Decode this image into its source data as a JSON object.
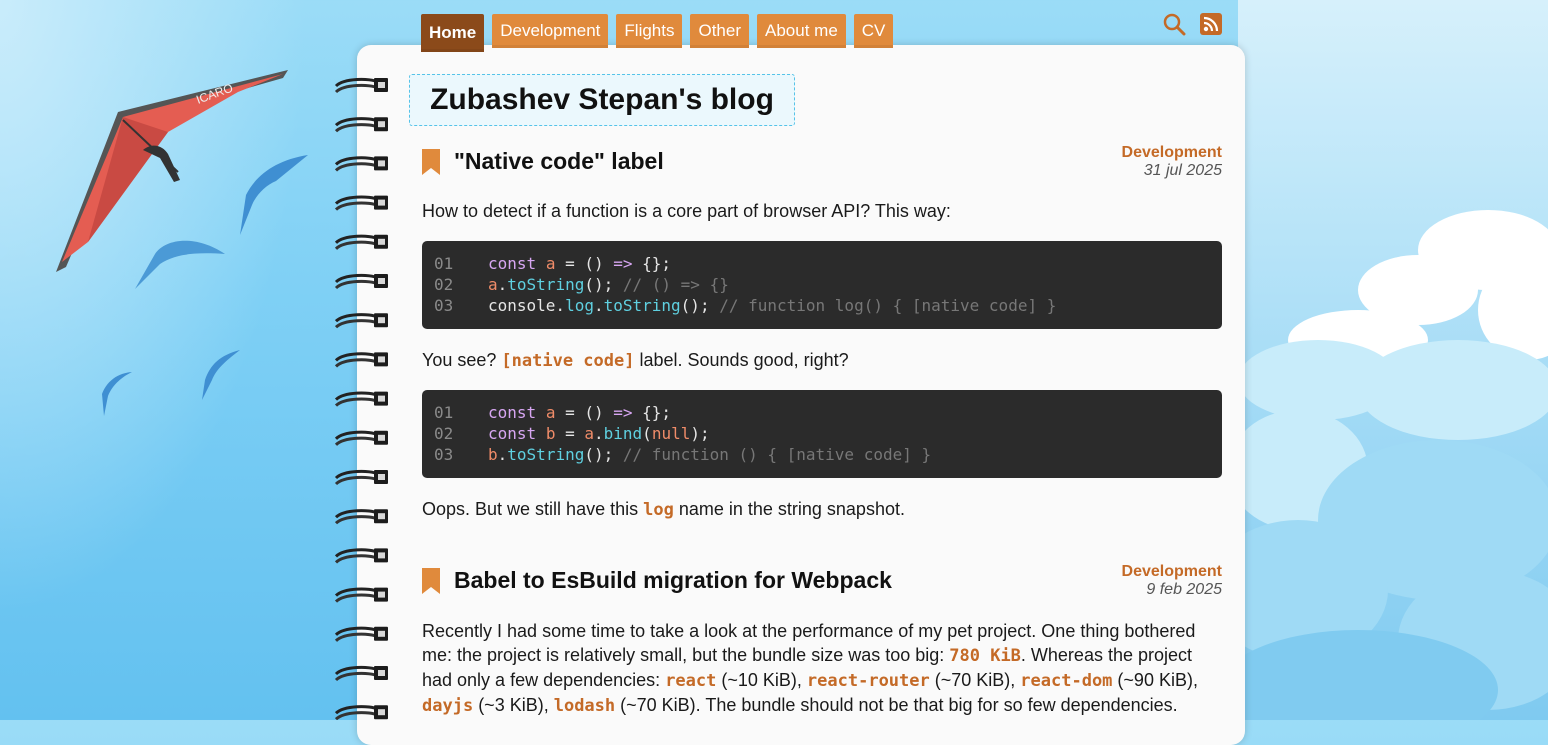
{
  "nav": {
    "tabs": [
      {
        "label": "Home",
        "active": true
      },
      {
        "label": "Development",
        "active": false
      },
      {
        "label": "Flights",
        "active": false
      },
      {
        "label": "Other",
        "active": false
      },
      {
        "label": "About me",
        "active": false
      },
      {
        "label": "CV",
        "active": false
      }
    ],
    "icons": [
      "search-icon",
      "rss-icon"
    ]
  },
  "blog_title": "Zubashev Stepan's blog",
  "posts": [
    {
      "title": "\"Native code\" label",
      "category": "Development",
      "date": "31 jul 2025",
      "intro": "How to detect if a function is a core part of browser API? This way:",
      "code1": [
        {
          "n": "01",
          "text": "const a = () => {};"
        },
        {
          "n": "02",
          "text": "a.toString(); // () => {}"
        },
        {
          "n": "03",
          "text": "console.log.toString(); // function log() { [native code] }"
        }
      ],
      "para2_before": "You see? ",
      "para2_code": "[native code]",
      "para2_after": " label. Sounds good, right?",
      "code2": [
        {
          "n": "01",
          "text": "const a = () => {};"
        },
        {
          "n": "02",
          "text": "const b = a.bind(null);"
        },
        {
          "n": "03",
          "text": "b.toString(); // function () { [native code] }"
        }
      ],
      "para3_before": "Oops. But we still have this ",
      "para3_code": "log",
      "para3_after": " name in the string snapshot."
    },
    {
      "title": "Babel to EsBuild migration for Webpack",
      "category": "Development",
      "date": "9 feb 2025",
      "text_1": "Recently I had some time to take a look at the performance of my pet project. One thing bothered me: the project is relatively small, but the bundle size was too big: ",
      "code_1": "780 KiB",
      "text_2": ". Whereas the project had only a few dependencies: ",
      "code_2": "react",
      "text_3": " (~10 KiB), ",
      "code_3": "react-router",
      "text_4": " (~70 KiB), ",
      "code_4": "react-dom",
      "text_5": " (~90 KiB), ",
      "code_5": "dayjs",
      "text_6": " (~3 KiB), ",
      "code_6": "lodash",
      "text_7": " (~70 KiB). The bundle should not be that big for so few dependencies."
    }
  ],
  "colors": {
    "accent": "#e08a3c",
    "active_tab": "#8b4a1a",
    "category": "#c46a27",
    "code_bg": "#2b2b2b",
    "title_border": "#56c3e8"
  }
}
